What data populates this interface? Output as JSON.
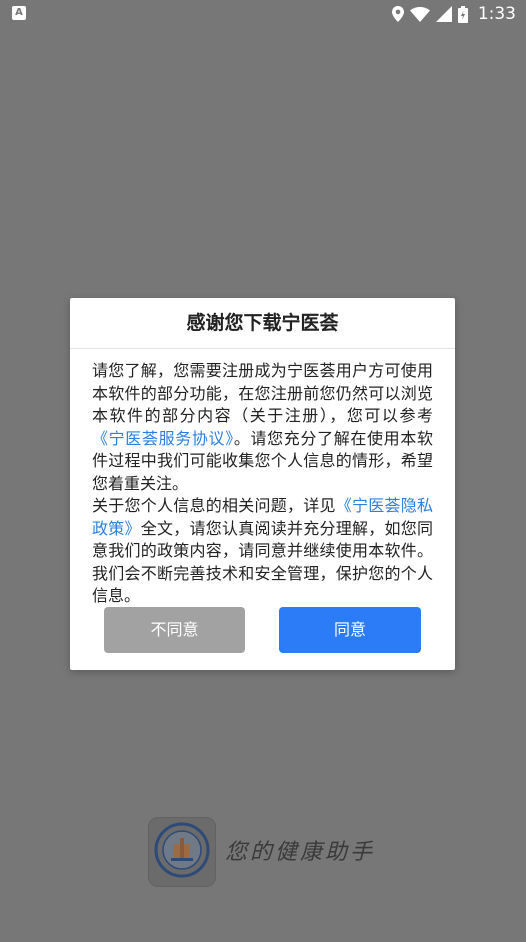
{
  "status_bar": {
    "time": "1:33",
    "app_icon_label": "A"
  },
  "dialog": {
    "title": "感谢您下载宁医荟",
    "paragraph1": {
      "before_link": "请您了解，您需要注册成为宁医荟用户方可使用本软件的部分功能，在您注册前您仍然可以浏览本软件的部分内容（关于注册），您可以参考",
      "link": "《宁医荟服务协议》",
      "after_link": "。请您充分了解在使用本软件过程中我们可能收集您个人信息的情形，希望您着重关注。"
    },
    "paragraph2": {
      "before_link": "关于您个人信息的相关问题，详见",
      "link": "《宁医荟隐私政策》",
      "after_link": "全文，请您认真阅读并充分理解，如您同意我们的政策内容，请同意并继续使用本软件。我们会不断完善技术和安全管理，保护您的个人信息。"
    },
    "disagree_label": "不同意",
    "agree_label": "同意"
  },
  "splash": {
    "slogan": "您的健康助手",
    "logo_icon": "hospital-logo-icon"
  },
  "colors": {
    "overlay": "#777777",
    "link": "#2c7fe0",
    "agree": "#2b7cf6",
    "disagree": "#a2a2a2"
  }
}
